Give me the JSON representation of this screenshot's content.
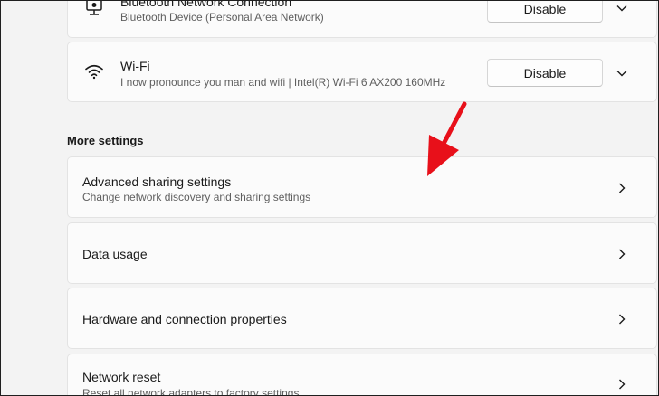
{
  "adapters": [
    {
      "name": "Bluetooth Network Connection",
      "description": "Bluetooth Device (Personal Area Network)",
      "button_label": "Disable",
      "icon": "bluetooth-network-icon"
    },
    {
      "name": "Wi-Fi",
      "description": "I now pronounce you man and wifi | Intel(R) Wi-Fi 6 AX200 160MHz",
      "button_label": "Disable",
      "icon": "wifi-icon"
    }
  ],
  "more_settings": {
    "heading": "More settings",
    "items": [
      {
        "title": "Advanced sharing settings",
        "subtitle": "Change network discovery and sharing settings"
      },
      {
        "title": "Data usage"
      },
      {
        "title": "Hardware and connection properties"
      },
      {
        "title": "Network reset",
        "subtitle": "Reset all network adapters to factory settings"
      }
    ]
  },
  "colors": {
    "annotation_arrow": "#e8101a",
    "page_background": "#f3f3f3",
    "card_background": "#fbfbfb"
  }
}
